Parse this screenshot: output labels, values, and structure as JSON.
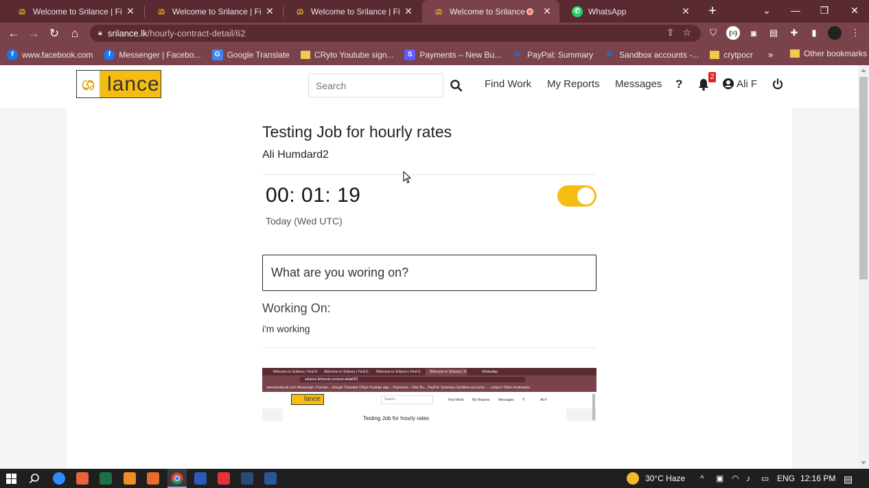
{
  "browser": {
    "tabs": [
      {
        "title": "Welcome to Srilance | Find D",
        "active": false
      },
      {
        "title": "Welcome to Srilance | Find D",
        "active": false
      },
      {
        "title": "Welcome to Srilance | Find D",
        "active": false
      },
      {
        "title": "Welcome to Srilance | Fir",
        "active": true
      },
      {
        "title": "WhatsApp",
        "active": false
      }
    ],
    "url_host": "srilance.lk",
    "url_path": "/hourly-contract-detail/62",
    "bookmarks": [
      "www.facebook.com",
      "Messenger | Facebo...",
      "Google Translate",
      "CRyto Youtube sign...",
      "Payments – New Bu...",
      "PayPal: Summary",
      "Sandbox accounts -...",
      "crytpocr"
    ],
    "other_bookmarks": "Other bookmarks"
  },
  "header": {
    "logo_text": "lance",
    "search_placeholder": "Search",
    "nav": {
      "find_work": "Find Work",
      "my_reports": "My Reports",
      "messages": "Messages"
    },
    "help": "?",
    "notification_count": "2",
    "user_name": "Ali F"
  },
  "contract": {
    "job_title": "Testing Job for hourly rates",
    "client_name": "Ali Humdard2",
    "timer": "00: 01: 19",
    "period_label": "Today (Wed UTC)",
    "timer_running": true,
    "task_placeholder": "What are you woring on?",
    "working_on_label": "Working On:",
    "working_on_value": "i'm working"
  },
  "thumbnail": {
    "title": "Testing Job for hourly rates",
    "url": "srilance.lk/hourly-contract-detail/62",
    "logo_text": "lance",
    "search": "Search",
    "nav": [
      "Find Work",
      "My Reports",
      "Messages",
      "?",
      "Ali F"
    ],
    "tabs": [
      "Welcome to Srilance | Find D",
      "Welcome to Srilance | Find D",
      "Welcome to Srilance | Find D",
      "Welcome to Srilance | Fi",
      "WhatsApp"
    ],
    "bookmarks": "www.facebook.com   Messenger | Facebo...   Google Translate   CRyto Youtube sign...   Payments – New Bu...   PayPal: Summary   Sandbox accounts -...   crytpocr            Other bookmarks"
  },
  "taskbar": {
    "weather": "30°C  Haze",
    "language": "ENG",
    "time": "12:16 PM"
  },
  "colors": {
    "brand_yellow": "#f5bc12",
    "chrome_dark": "#5a2a33",
    "chrome_mid": "#7a434c"
  }
}
